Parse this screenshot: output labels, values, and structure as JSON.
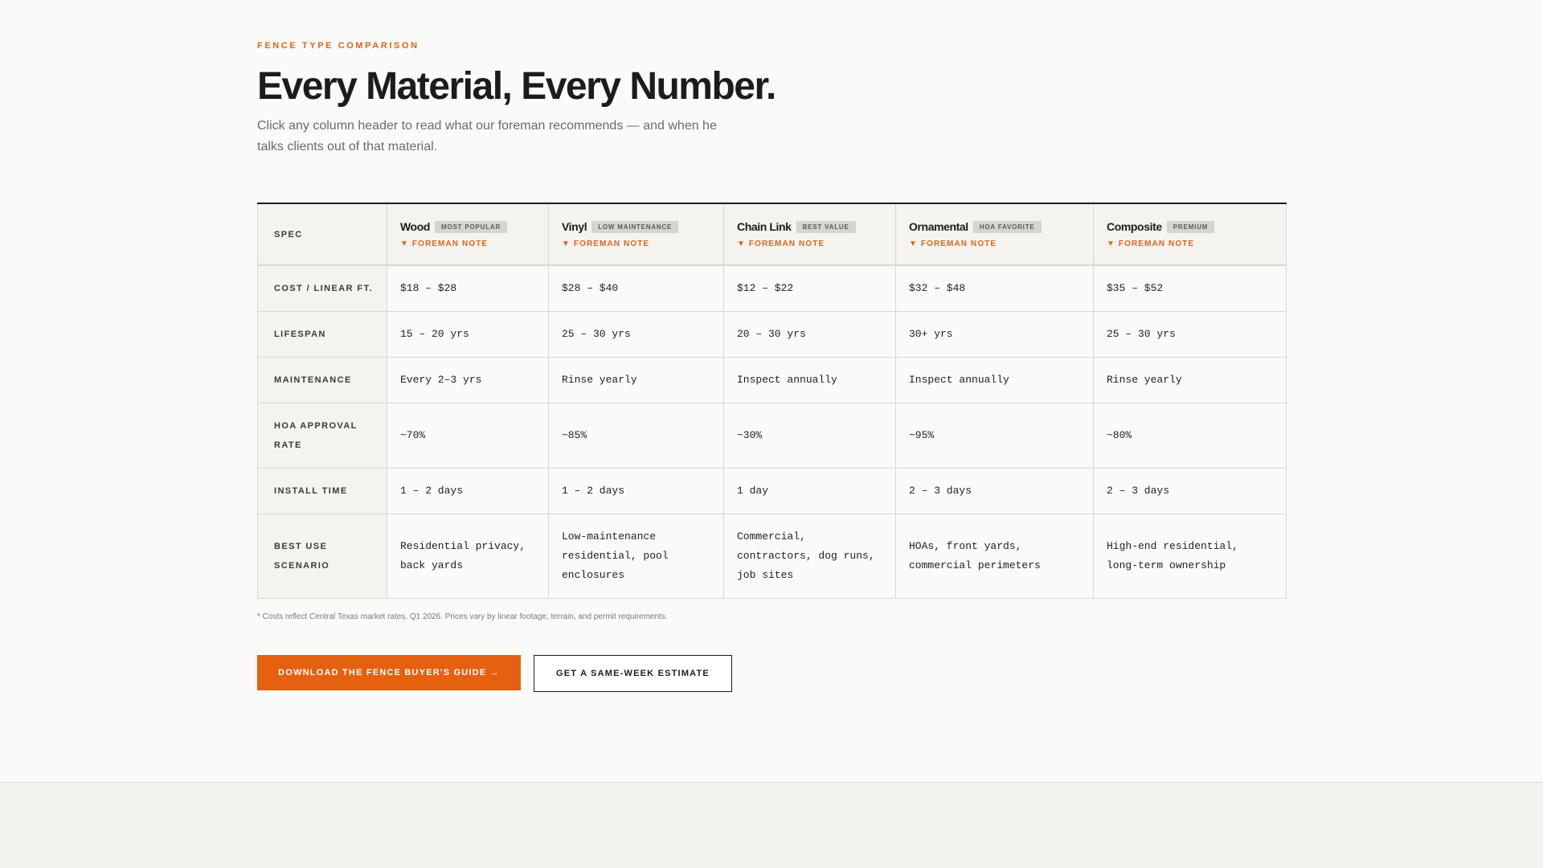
{
  "header": {
    "eyebrow": "FENCE TYPE COMPARISON",
    "title": "Every Material, Every Number.",
    "subtitle": "Click any column header to read what our foreman recommends — and when he talks clients out of that material."
  },
  "table": {
    "spec_label": "SPEC",
    "note_label": "▼ FOREMAN NOTE",
    "columns": [
      {
        "name": "Wood",
        "badge": "MOST POPULAR"
      },
      {
        "name": "Vinyl",
        "badge": "LOW MAINTENANCE"
      },
      {
        "name": "Chain Link",
        "badge": "BEST VALUE"
      },
      {
        "name": "Ornamental",
        "badge": "HOA FAVORITE"
      },
      {
        "name": "Composite",
        "badge": "PREMIUM"
      }
    ],
    "rows": [
      {
        "label": "COST / LINEAR FT.",
        "values": [
          "$18 – $28",
          "$28 – $40",
          "$12 – $22",
          "$32 – $48",
          "$35 – $52"
        ]
      },
      {
        "label": "LIFESPAN",
        "values": [
          "15 – 20 yrs",
          "25 – 30 yrs",
          "20 – 30 yrs",
          "30+ yrs",
          "25 – 30 yrs"
        ]
      },
      {
        "label": "MAINTENANCE",
        "values": [
          "Every 2–3 yrs",
          "Rinse yearly",
          "Inspect annually",
          "Inspect annually",
          "Rinse yearly"
        ]
      },
      {
        "label": "HOA APPROVAL RATE",
        "values": [
          "~70%",
          "~85%",
          "~30%",
          "~95%",
          "~80%"
        ]
      },
      {
        "label": "INSTALL TIME",
        "values": [
          "1 – 2 days",
          "1 – 2 days",
          "1 day",
          "2 – 3 days",
          "2 – 3 days"
        ]
      },
      {
        "label": "BEST USE SCENARIO",
        "values": [
          "Residential privacy, back yards",
          "Low-maintenance residential, pool enclosures",
          "Commercial, contractors, dog runs, job sites",
          "HOAs, front yards, commercial perimeters",
          "High-end residential, long-term ownership"
        ]
      }
    ]
  },
  "footnote": "* Costs reflect Central Texas market rates, Q1 2026. Prices vary by linear footage, terrain, and permit requirements.",
  "actions": {
    "primary_label": "DOWNLOAD THE FENCE BUYER'S GUIDE →",
    "secondary_label": "GET A SAME-WEEK ESTIMATE"
  },
  "colors": {
    "accent": "#e5600f",
    "text": "#1c1c1c",
    "background": "#fafaf9"
  }
}
